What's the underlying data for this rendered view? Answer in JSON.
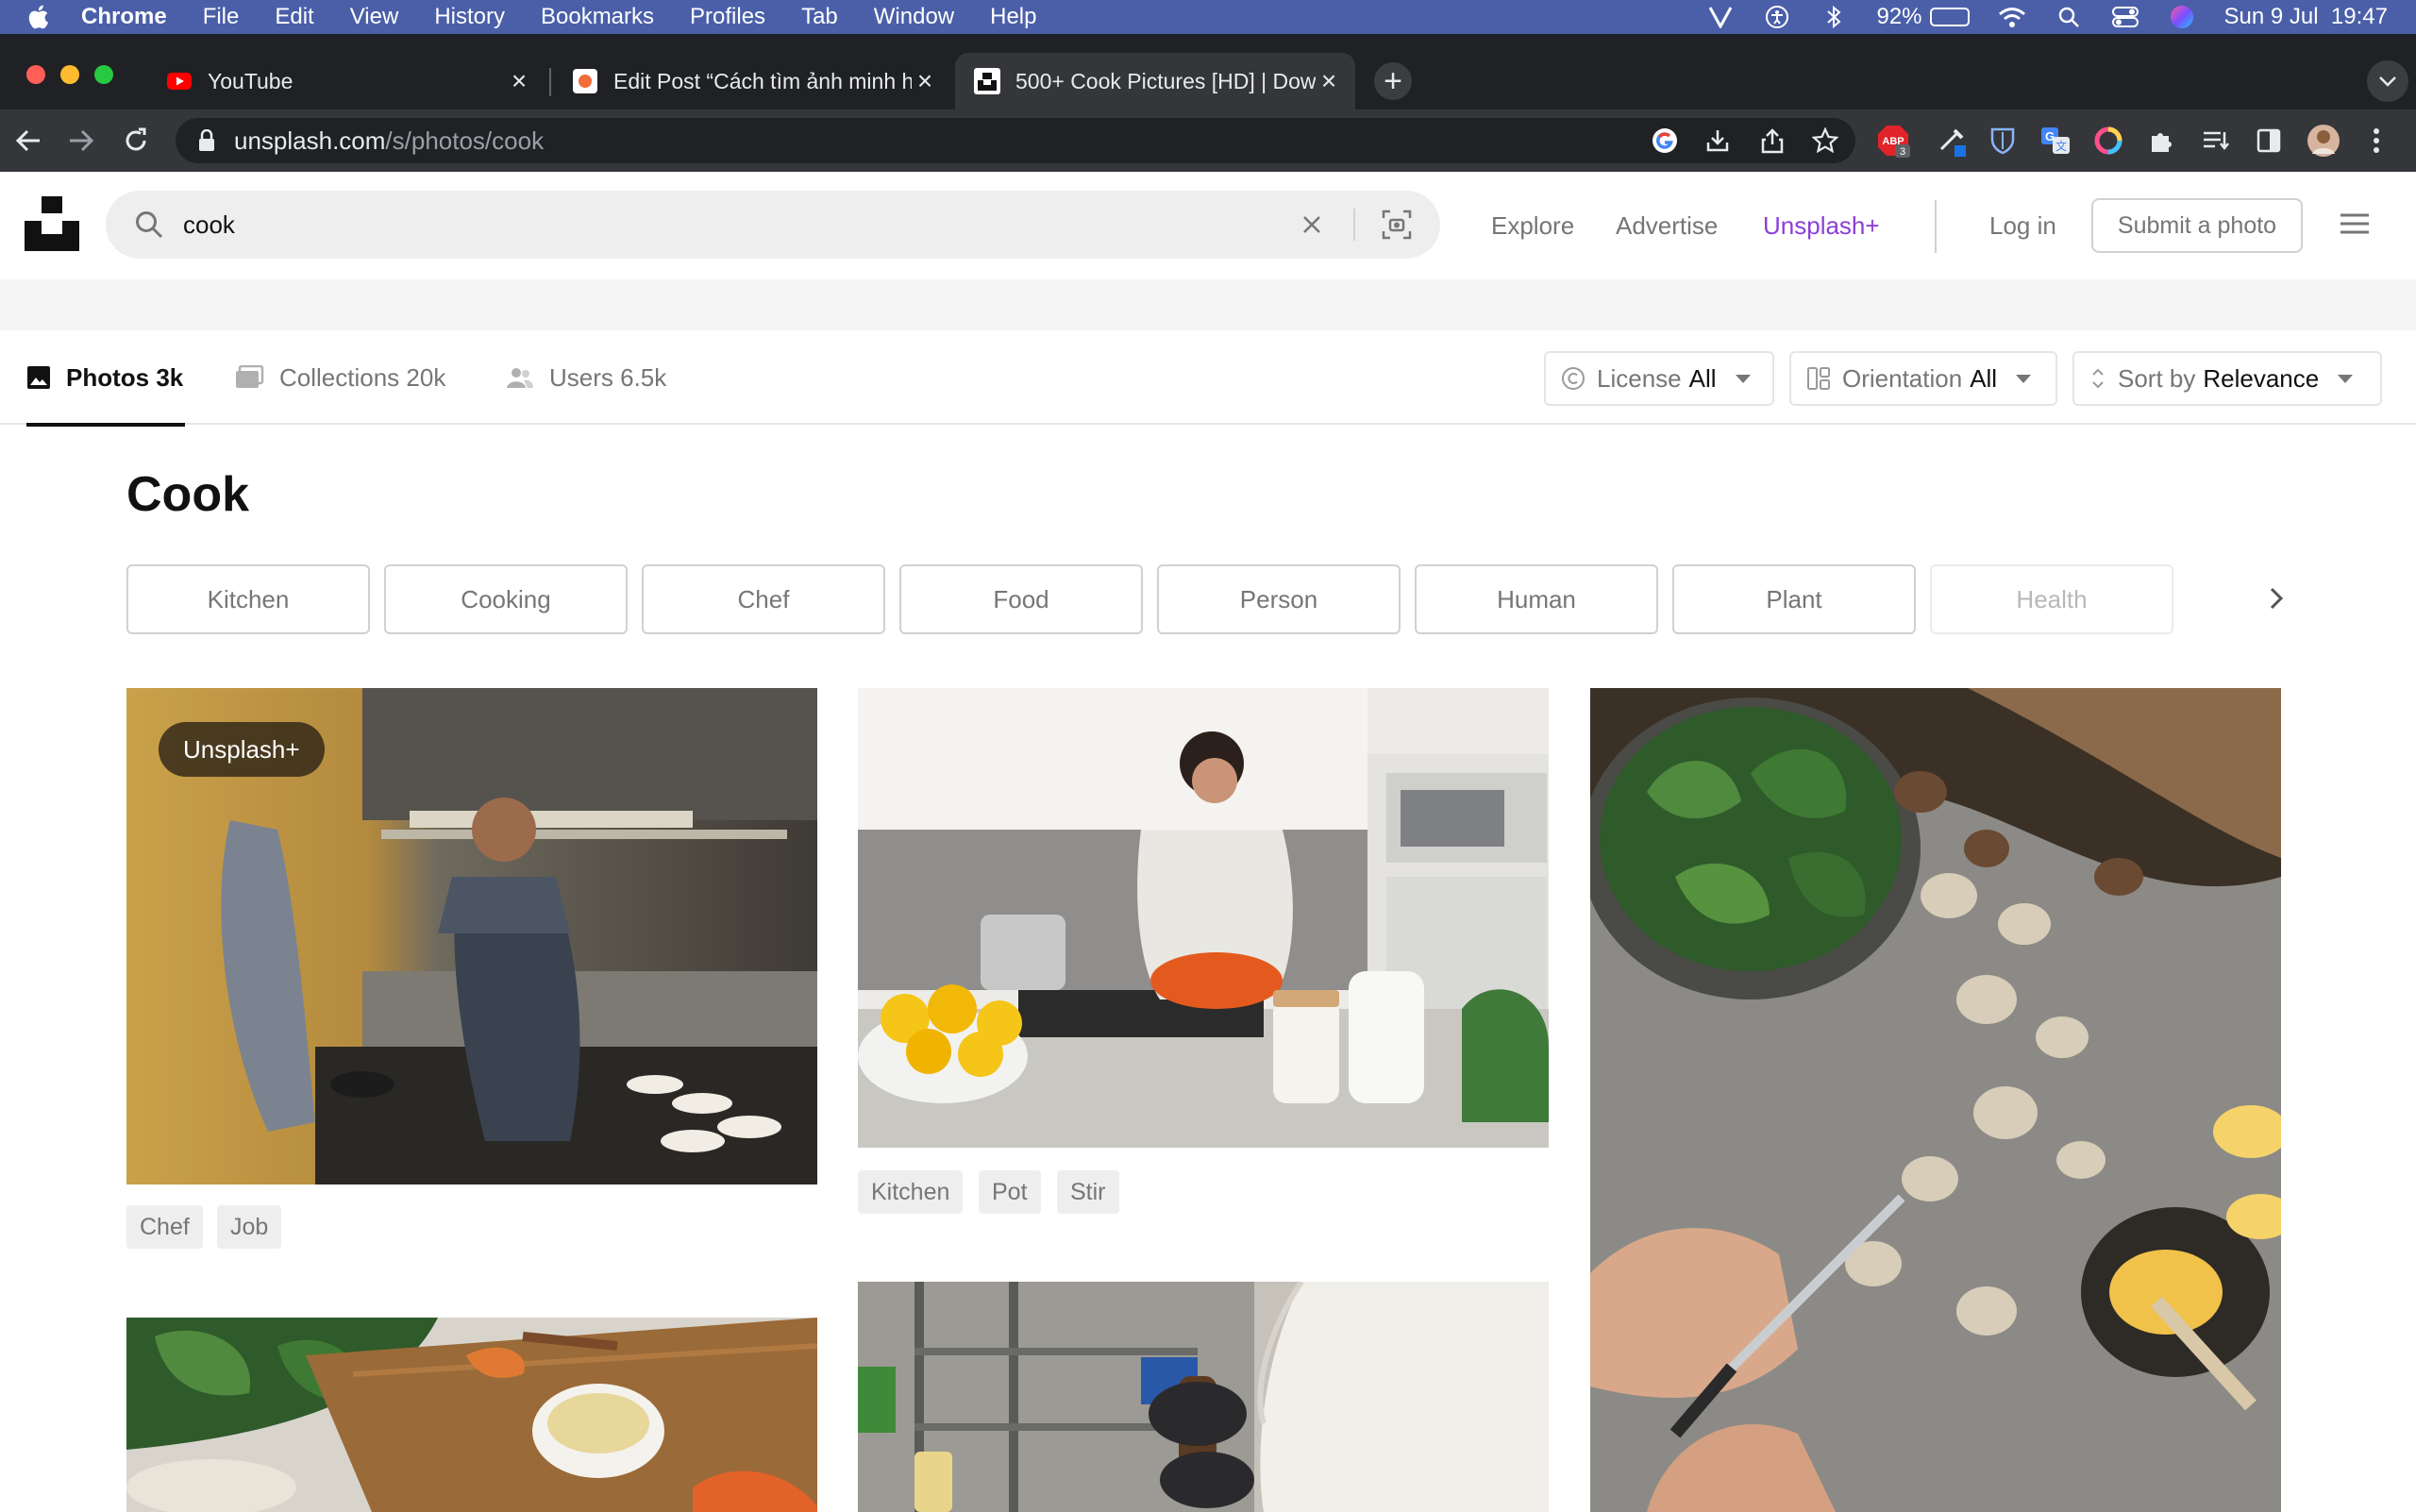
{
  "menubar": {
    "app": "Chrome",
    "items": [
      "File",
      "Edit",
      "View",
      "History",
      "Bookmarks",
      "Profiles",
      "Tab",
      "Window",
      "Help"
    ],
    "battery": "92%",
    "datetime": "Sun 9 Jul  19:47"
  },
  "tabs": [
    {
      "title": "YouTube"
    },
    {
      "title": "Edit Post “Cách tìm ảnh minh h"
    },
    {
      "title": "500+ Cook Pictures [HD] | Dow"
    }
  ],
  "toolbar": {
    "url_host": "unsplash.com",
    "url_path": "/s/photos/cook",
    "adblock_count": "3"
  },
  "header": {
    "search_value": "cook",
    "nav": {
      "explore": "Explore",
      "advertise": "Advertise",
      "plus": "Unsplash+",
      "login": "Log in"
    },
    "submit": "Submit a photo"
  },
  "filters": {
    "tabs": [
      {
        "label": "Photos 3k"
      },
      {
        "label": "Collections 20k"
      },
      {
        "label": "Users 6.5k"
      }
    ],
    "license": {
      "label": "License",
      "value": "All"
    },
    "orientation": {
      "label": "Orientation",
      "value": "All"
    },
    "sort": {
      "label": "Sort by",
      "value": "Relevance"
    }
  },
  "page": {
    "title": "Cook",
    "related": [
      "Kitchen",
      "Cooking",
      "Chef",
      "Food",
      "Person",
      "Human",
      "Plant",
      "Health"
    ]
  },
  "photos": {
    "p1": {
      "badge": "Unsplash+",
      "tags": [
        "Chef",
        "Job"
      ]
    },
    "p2": {
      "tags": [
        "Kitchen",
        "Pot",
        "Stir"
      ]
    }
  },
  "colors": {
    "menubar": "#4a5fa8",
    "tabstrip": "#202124",
    "toolbar": "#35363a",
    "unsplash_plus": "#8b3fd9"
  }
}
